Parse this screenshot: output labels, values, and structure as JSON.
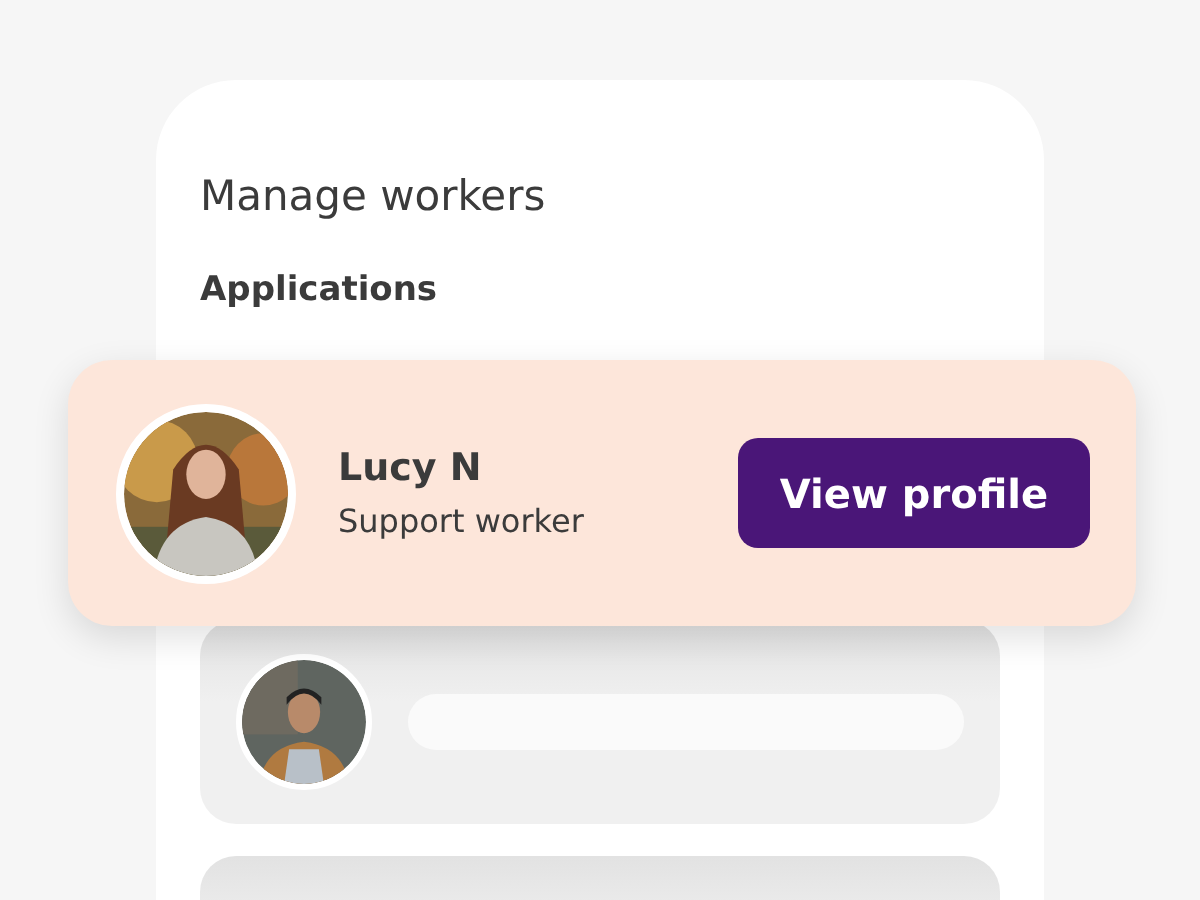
{
  "screen": {
    "title": "Manage workers",
    "section": "Applications"
  },
  "featured_applicant": {
    "name": "Lucy N",
    "role": "Support worker",
    "button": "View profile"
  },
  "list_rows": [
    {
      "kind": "skeleton-with-avatar"
    },
    {
      "kind": "skeleton"
    }
  ]
}
